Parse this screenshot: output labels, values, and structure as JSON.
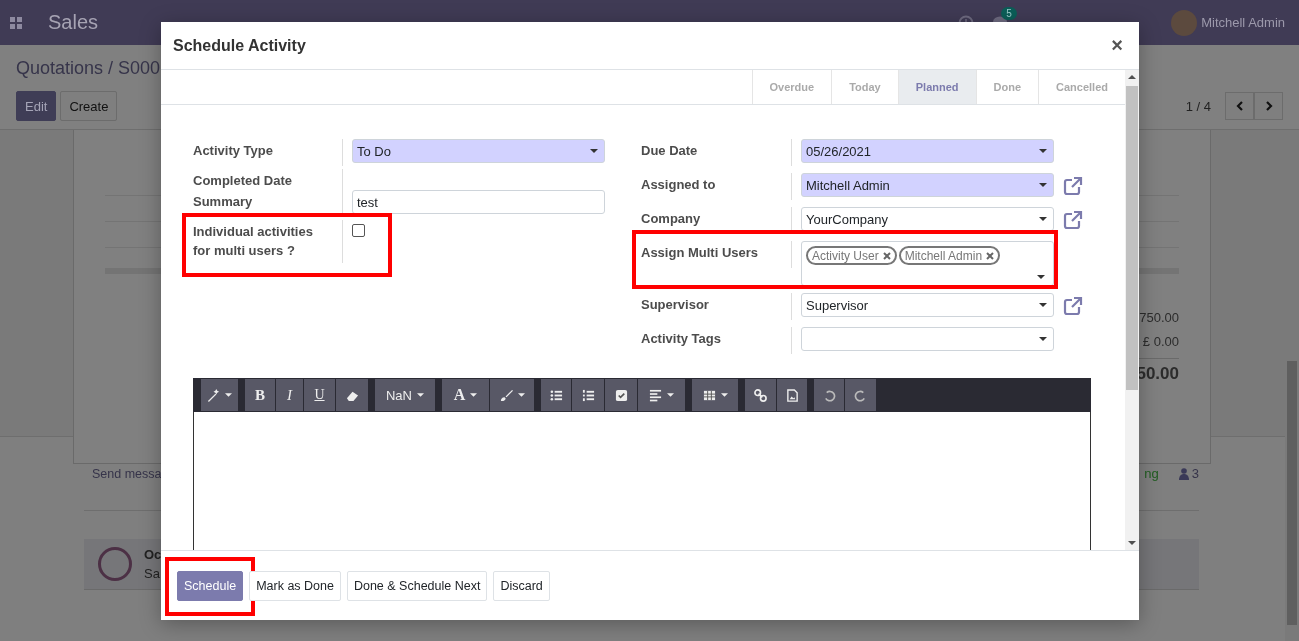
{
  "background": {
    "app_name": "Sales",
    "notifications": "5",
    "user": "Mitchell Admin",
    "breadcrumb": "Quotations / S000",
    "buttons": [
      "Edit",
      "Create"
    ],
    "pager": "1 / 4",
    "amounts": [
      {
        "text": "750.00",
        "kind": "line"
      },
      {
        "text": "£ 0.00",
        "kind": "line"
      },
      {
        "text": "50.00",
        "kind": "total"
      }
    ],
    "chatter": {
      "send": "Send messa",
      "follow": "ng",
      "followers": "3",
      "message": {
        "author": "Oc",
        "text": "Sa"
      }
    }
  },
  "dialog": {
    "title": "Schedule Activity",
    "close": "×",
    "stages": [
      {
        "label": "Overdue",
        "selected": false
      },
      {
        "label": "Today",
        "selected": false
      },
      {
        "label": "Planned",
        "selected": true
      },
      {
        "label": "Done",
        "selected": false
      },
      {
        "label": "Cancelled",
        "selected": false
      }
    ],
    "left_fields": [
      {
        "label": "Activity Type",
        "kind": "select",
        "value": "To Do",
        "required": true,
        "highlighted": false
      },
      {
        "label": "Completed Date",
        "kind": "empty",
        "highlighted": false
      },
      {
        "label": "Summary",
        "kind": "input",
        "value": "test",
        "required": false,
        "highlighted": false
      },
      {
        "label": "Individual activities for multi users ?",
        "kind": "checkbox",
        "checked": false,
        "highlighted": true
      }
    ],
    "right_fields": [
      {
        "label": "Due Date",
        "kind": "select",
        "value": "05/26/2021",
        "required": true,
        "link": false,
        "highlighted": false
      },
      {
        "label": "Assigned to",
        "kind": "select",
        "value": "Mitchell Admin",
        "required": true,
        "link": true,
        "highlighted": false
      },
      {
        "label": "Company",
        "kind": "select",
        "value": "YourCompany",
        "required": false,
        "link": true,
        "highlighted": false
      },
      {
        "label": "Assign Multi Users",
        "kind": "tags",
        "tags": [
          "Activity User",
          "Mitchell Admin"
        ],
        "required": false,
        "link": false,
        "highlighted": true
      },
      {
        "label": "Supervisor",
        "kind": "select",
        "value": "Supervisor",
        "required": false,
        "link": true,
        "highlighted": false
      },
      {
        "label": "Activity Tags",
        "kind": "select",
        "required": false,
        "link": false,
        "highlighted": false
      }
    ],
    "editor": {
      "font_size": "NaN",
      "bold": "B",
      "italic": "I",
      "underline": "U",
      "font_letter": "A"
    },
    "buttons": [
      {
        "label": "Schedule",
        "primary": true,
        "highlighted": true
      },
      {
        "label": "Mark as Done",
        "primary": false,
        "highlighted": false
      },
      {
        "label": "Done & Schedule Next",
        "primary": false,
        "highlighted": false
      },
      {
        "label": "Discard",
        "primary": false,
        "highlighted": false
      }
    ]
  }
}
